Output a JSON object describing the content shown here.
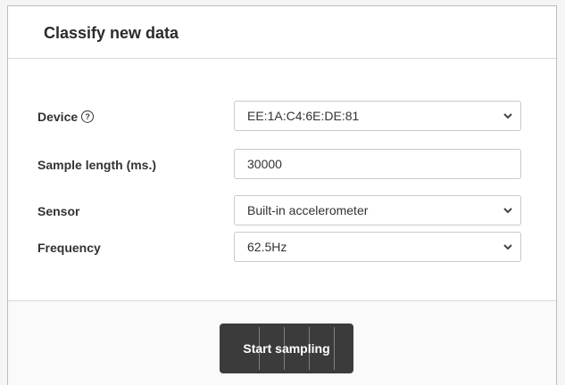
{
  "card": {
    "title": "Classify new data"
  },
  "form": {
    "device": {
      "label": "Device",
      "value": "EE:1A:C4:6E:DE:81",
      "help_icon": "question-circle-icon"
    },
    "sample_length": {
      "label": "Sample length (ms.)",
      "value": "30000"
    },
    "sensor": {
      "label": "Sensor",
      "value": "Built-in accelerometer"
    },
    "frequency": {
      "label": "Frequency",
      "value": "62.5Hz"
    }
  },
  "footer": {
    "start_label": "Start sampling"
  },
  "colors": {
    "button_bg": "#3b3b3b",
    "text": "#333333"
  }
}
